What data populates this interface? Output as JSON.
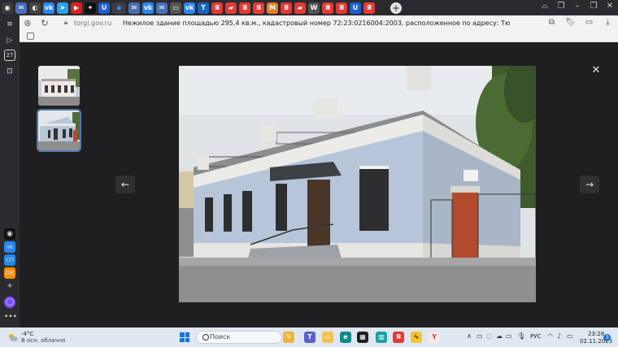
{
  "browser": {
    "tabs": [
      {
        "icon": "camera-icon",
        "color": "#3a3a3a",
        "glyph": "◉"
      },
      {
        "icon": "mail-icon",
        "color": "#4a6fb5",
        "glyph": "✉"
      },
      {
        "icon": "github-icon",
        "color": "#444",
        "glyph": "◐"
      },
      {
        "icon": "vk-icon",
        "color": "#2787f5",
        "glyph": "vk"
      },
      {
        "icon": "telegram-icon",
        "color": "#2aa3e0",
        "glyph": "➤"
      },
      {
        "icon": "youtube-icon",
        "color": "#e02020",
        "glyph": "▶"
      },
      {
        "icon": "dzen-icon",
        "color": "#111",
        "glyph": "✦"
      },
      {
        "icon": "u-icon",
        "color": "#1d5fd0",
        "glyph": "U"
      },
      {
        "icon": "active-tab-icon",
        "color": "#3a8ee6",
        "glyph": "◆"
      },
      {
        "icon": "mail2-icon",
        "color": "#4a6fb5",
        "glyph": "✉"
      },
      {
        "icon": "vk2-icon",
        "color": "#2787f5",
        "glyph": "vk"
      },
      {
        "icon": "mail3-icon",
        "color": "#4a6fb5",
        "glyph": "✉"
      },
      {
        "icon": "doc-icon",
        "color": "#555",
        "glyph": "▭"
      },
      {
        "icon": "vk3-icon",
        "color": "#2787f5",
        "glyph": "vk"
      },
      {
        "icon": "t-icon",
        "color": "#1565c0",
        "glyph": "T"
      },
      {
        "icon": "yandex-icon",
        "color": "#e53935",
        "glyph": "Я"
      },
      {
        "icon": "flag-icon",
        "color": "#e53935",
        "glyph": "▰"
      },
      {
        "icon": "yandex2-icon",
        "color": "#e53935",
        "glyph": "Я"
      },
      {
        "icon": "yandex3-icon",
        "color": "#e53935",
        "glyph": "Я"
      },
      {
        "icon": "ms-icon",
        "color": "#e67e22",
        "glyph": "M"
      },
      {
        "icon": "yandex4-icon",
        "color": "#e53935",
        "glyph": "Я"
      },
      {
        "icon": "flag2-icon",
        "color": "#e53935",
        "glyph": "▰"
      },
      {
        "icon": "w-icon",
        "color": "#555",
        "glyph": "W"
      },
      {
        "icon": "yandex5-icon",
        "color": "#e53935",
        "glyph": "Я"
      },
      {
        "icon": "yandex6-icon",
        "color": "#e53935",
        "glyph": "Я"
      },
      {
        "icon": "u2-icon",
        "color": "#1d5fd0",
        "glyph": "U"
      },
      {
        "icon": "yandex7-icon",
        "color": "#e53935",
        "glyph": "Я"
      }
    ],
    "domain": "torgi.gov.ru",
    "page_title": "Нежилое здание площадью 295,4 кв.м., кадастровый номер 72:23:0216004:2003, расположенное по адресу: Тюменская обл., г. Т..."
  },
  "taskbar": {
    "weather_temp": "-4°C",
    "weather_desc": "В осн. облачно",
    "search_label": "Поиск",
    "language": "РУС",
    "time": "23:28",
    "date": "02.11.2023",
    "notifications": "3"
  }
}
